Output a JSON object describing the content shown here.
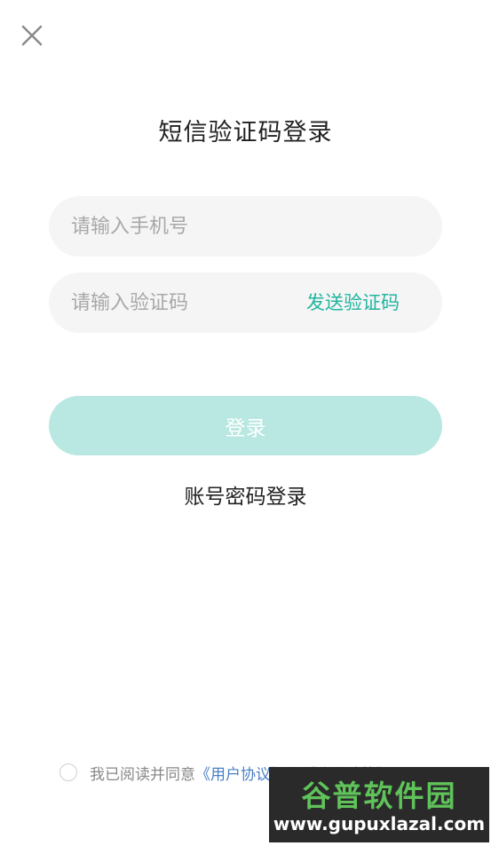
{
  "header": {
    "close_icon": "close-icon",
    "title": "短信验证码登录"
  },
  "form": {
    "phone_placeholder": "请输入手机号",
    "phone_value": "",
    "code_placeholder": "请输入验证码",
    "code_value": "",
    "send_code_label": "发送验证码",
    "login_label": "登录",
    "alt_login_label": "账号密码登录"
  },
  "agreement": {
    "checked": false,
    "prefix": "我已阅读并同意",
    "user_agreement": "《用户协议》",
    "connector": "与",
    "privacy_policy": "《隐私政策》"
  },
  "watermark": {
    "logo_text": "谷普软件园",
    "url_text": "www.gupuxlazal.com"
  },
  "colors": {
    "accent": "#22b5a0",
    "button_disabled": "#b8e8e1",
    "field_bg": "#f5f5f5",
    "link": "#4a7fc4"
  }
}
